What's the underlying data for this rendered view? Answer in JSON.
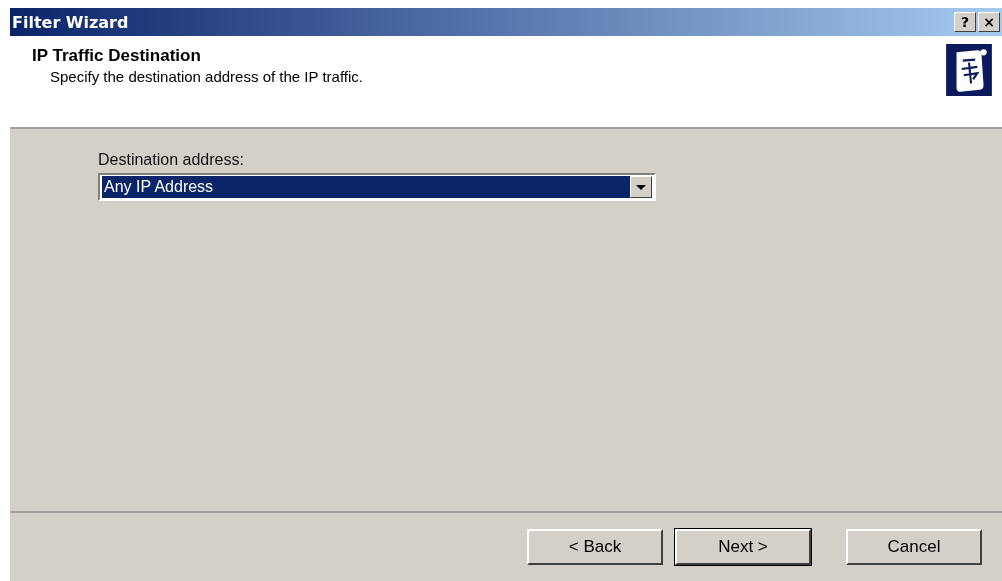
{
  "window": {
    "title": "Filter Wizard",
    "controls": [
      "?",
      "×"
    ]
  },
  "header": {
    "title": "IP Traffic Destination",
    "subtitle": "Specify the destination address of the IP traffic."
  },
  "field": {
    "label": "Destination address:",
    "value": "Any IP Address",
    "highlighted": true
  },
  "buttons": [
    {
      "label": "< Back",
      "default": false
    },
    {
      "label": "Next >",
      "default": true
    },
    {
      "label": "Cancel",
      "default": false
    }
  ]
}
